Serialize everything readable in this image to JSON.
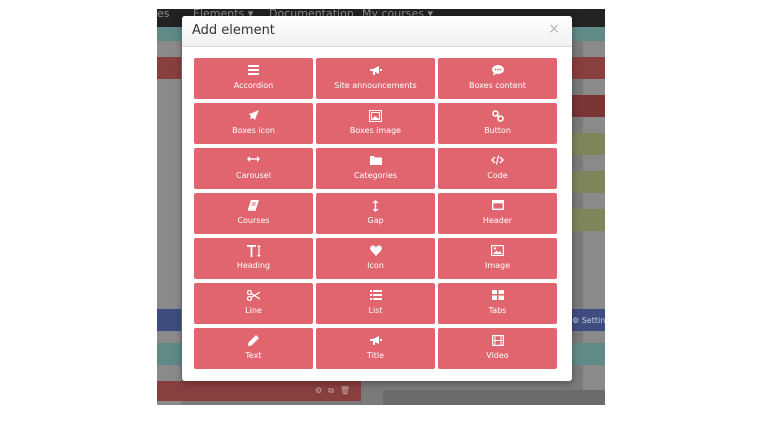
{
  "background": {
    "nav_items": [
      "es",
      "Elements ▾",
      "Documentation",
      "My courses ▾"
    ],
    "settings_label": "⚙ Settings"
  },
  "modal": {
    "title": "Add element",
    "close_glyph": "×",
    "tiles": [
      {
        "label": "Accordion",
        "icon": "list-bars-icon"
      },
      {
        "label": "Site announcements",
        "icon": "megaphone-icon"
      },
      {
        "label": "Boxes content",
        "icon": "comment-icon"
      },
      {
        "label": "Boxes icon",
        "icon": "rocket-icon"
      },
      {
        "label": "Boxes image",
        "icon": "image-frame-icon"
      },
      {
        "label": "Button",
        "icon": "link-icon"
      },
      {
        "label": "Carousel",
        "icon": "arrows-horizontal-icon"
      },
      {
        "label": "Categories",
        "icon": "folder-icon"
      },
      {
        "label": "Code",
        "icon": "code-icon"
      },
      {
        "label": "Courses",
        "icon": "book-icon"
      },
      {
        "label": "Gap",
        "icon": "arrows-vertical-icon"
      },
      {
        "label": "Header",
        "icon": "window-icon"
      },
      {
        "label": "Heading",
        "icon": "text-height-icon"
      },
      {
        "label": "Icon",
        "icon": "heart-icon"
      },
      {
        "label": "Image",
        "icon": "picture-icon"
      },
      {
        "label": "Line",
        "icon": "scissors-icon"
      },
      {
        "label": "List",
        "icon": "list-icon"
      },
      {
        "label": "Tabs",
        "icon": "tabs-grid-icon"
      },
      {
        "label": "Text",
        "icon": "pencil-icon"
      },
      {
        "label": "Title",
        "icon": "megaphone-icon"
      },
      {
        "label": "Video",
        "icon": "film-icon"
      }
    ]
  },
  "colors": {
    "tile_background": "#e0656f",
    "tile_text": "#ffffff",
    "overlay_red": "#8a3f3f",
    "overlay_green": "#5f8a86",
    "overlay_olive": "#7f845a",
    "overlay_blue": "#3f4d7e"
  }
}
